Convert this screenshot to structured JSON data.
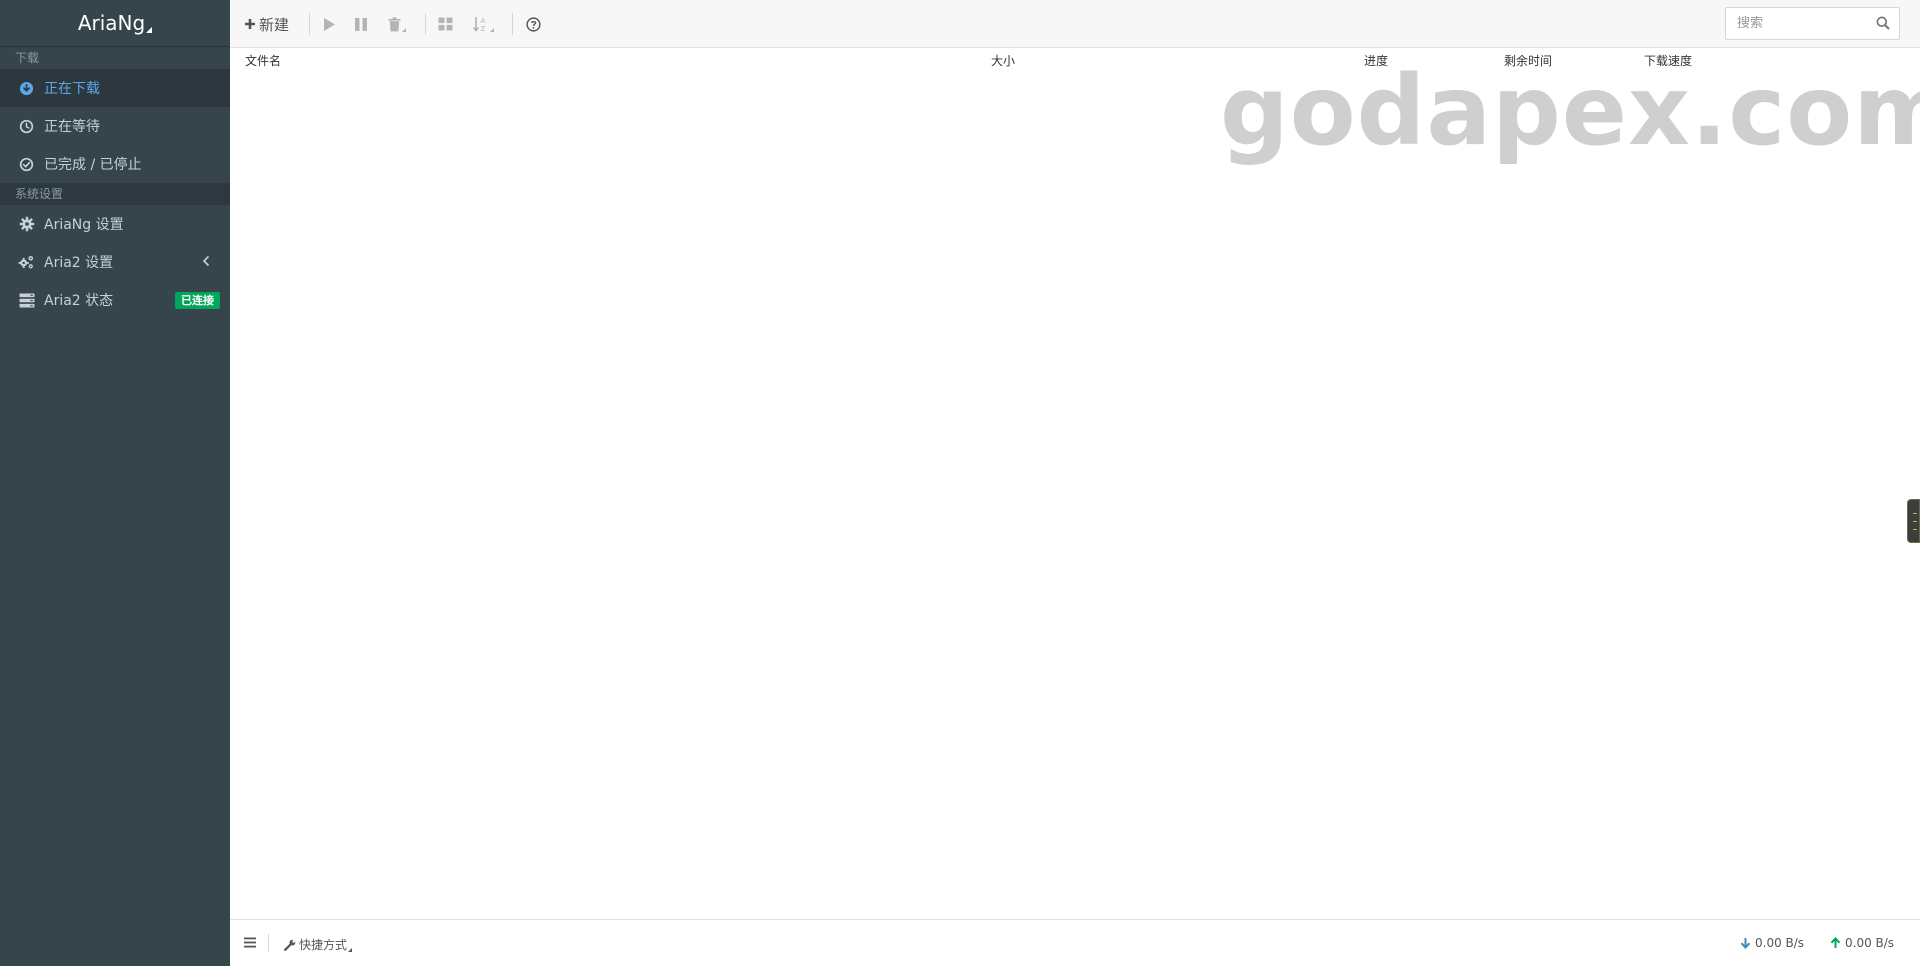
{
  "brand": {
    "title": "AriaNg"
  },
  "sidebar": {
    "download_header": "下载",
    "settings_header": "系统设置",
    "items": [
      {
        "label": "正在下载",
        "icon": "download-circle-icon",
        "active": true
      },
      {
        "label": "正在等待",
        "icon": "clock-icon",
        "active": false
      },
      {
        "label": "已完成 / 已停止",
        "icon": "check-circle-icon",
        "active": false
      },
      {
        "label": "AriaNg 设置",
        "icon": "gear-icon",
        "active": false
      },
      {
        "label": "Aria2 设置",
        "icon": "gears-icon",
        "active": false
      },
      {
        "label": "Aria2 状态",
        "icon": "server-icon",
        "active": false,
        "badge": "已连接"
      }
    ]
  },
  "toolbar": {
    "new_label": "新建",
    "search_placeholder": "搜索"
  },
  "table": {
    "columns": [
      "文件名",
      "大小",
      "进度",
      "剩余时间",
      "下载速度"
    ]
  },
  "watermark": "godapex.com",
  "footer": {
    "shortcut_label": "快捷方式",
    "download_speed": "0.00 B/s",
    "upload_speed": "0.00 B/s"
  },
  "colors": {
    "sidebar_bg": "#36444c",
    "active_blue": "#5aa8e8",
    "badge_green": "#00a65a",
    "download_arrow": "#3c8dbc",
    "upload_arrow": "#00a65a"
  }
}
